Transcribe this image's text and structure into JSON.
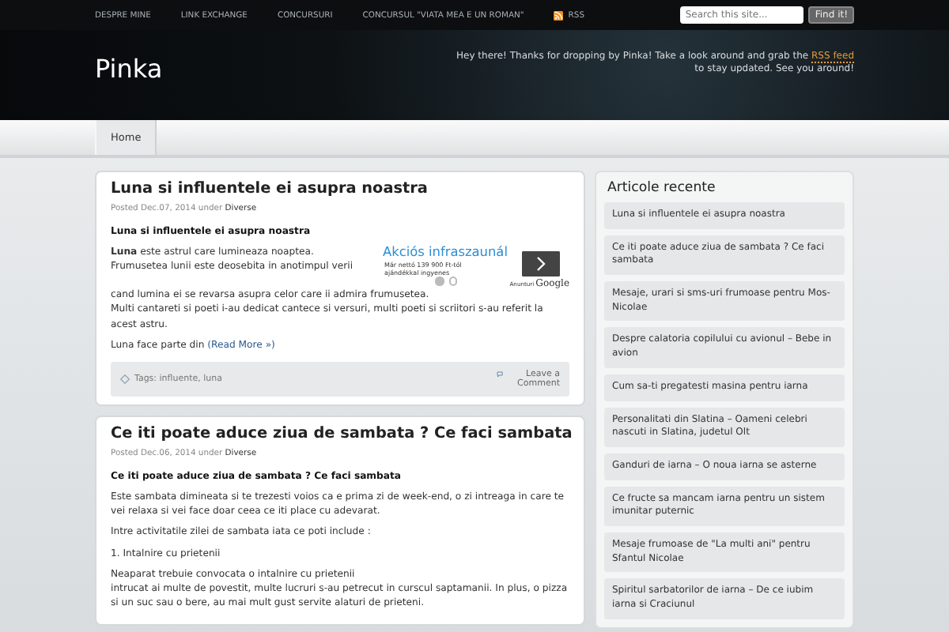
{
  "top_nav": {
    "items": [
      {
        "label": "DESPRE MINE",
        "kind": "link"
      },
      {
        "label": "LINK EXCHANGE",
        "kind": "link"
      },
      {
        "label": "CONCURSURI",
        "kind": "link"
      },
      {
        "label": "CONCURSUL \"VIATA MEA E UN ROMAN\"",
        "kind": "link"
      },
      {
        "label": "RSS",
        "kind": "rss"
      }
    ],
    "search": {
      "placeholder": "Search this site...",
      "button": "Find it!"
    }
  },
  "header": {
    "title": "Pinka",
    "tagline_before": "Hey there! Thanks for dropping by Pinka! Take a look around and grab the",
    "tagline_link": "RSS feed",
    "tagline_after": "to stay updated. See you around!"
  },
  "menu": [
    {
      "label": "Home",
      "selected": true
    }
  ],
  "posts": [
    {
      "title": "Luna si influentele ei asupra noastra",
      "posted": "Posted Dec.07, 2014 under",
      "category": "Diverse",
      "ad": {
        "title": "Akciós infraszaunál",
        "lines": [
          "Már nettó 139 900 Ft-tól",
          "ajándékkal ingyenes"
        ],
        "label": "Anunturi",
        "brand": "Google",
        "dots": [
          {
            "selected": true
          },
          {
            "selected": false
          }
        ]
      },
      "blocks": [
        {
          "kind": "heading",
          "text": "Luna si influentele ei asupra noastra"
        },
        {
          "kind": "adtext",
          "lines": [
            "**Luna** este astrul care lumineaza noaptea.",
            "Frumusetea lunii este deosebita in anotimpul verii"
          ]
        },
        {
          "kind": "text",
          "lines": [
            "cand lumina ei se revarsa asupra celor care ii admira frumusetea.",
            "Multi cantareti si poeti i-au dedicat cantece si versuri, multi poeti si scriitori s-au referit la acest astru."
          ]
        },
        {
          "kind": "more",
          "text": "Luna face parte din",
          "link": "(Read More »)"
        }
      ],
      "footer": {
        "tags": "Tags: influente, luna",
        "comment": "Leave a Comment"
      }
    },
    {
      "title": "Ce iti poate aduce ziua de sambata ? Ce faci sambata",
      "posted": "Posted Dec.06, 2014 under",
      "category": "Diverse",
      "blocks": [
        {
          "kind": "heading",
          "text": "Ce iti poate aduce ziua de sambata ? Ce faci sambata"
        },
        {
          "kind": "text",
          "lines": [
            "Este sambata dimineata si te trezesti voios ca e prima zi de week-end, o zi intreaga in care te vei relaxa si vei face doar ceea ce iti place cu adevarat."
          ]
        },
        {
          "kind": "text",
          "lines": [
            "Intre activitatile zilei de sambata iata ce poti include :"
          ]
        },
        {
          "kind": "text",
          "lines": [
            "1. Intalnire cu prietenii"
          ]
        },
        {
          "kind": "text",
          "lines": [
            "Neaparat trebuie convocata o intalnire cu prietenii",
            "intrucat ai multe de povestit, multe lucruri s-au petrecut in curscul saptamanii. In plus, o pizza si un suc sau o bere, au mai mult gust servite alaturi de prieteni."
          ]
        }
      ]
    }
  ],
  "sidebar": {
    "title": "Articole recente",
    "items": [
      "Luna si influentele ei asupra noastra",
      "Ce iti poate aduce ziua de sambata ? Ce faci sambata",
      "Mesaje, urari si sms-uri frumoase pentru Mos-Nicolae",
      "Despre calatoria copilului cu avionul – Bebe in avion",
      "Cum sa-ti pregatesti masina pentru iarna",
      "Personalitati din Slatina – Oameni celebri nascuti in Slatina, judetul Olt",
      "Ganduri de iarna – O noua iarna se asterne",
      "Ce fructe sa mancam iarna pentru un sistem imunitar puternic",
      "Mesaje frumoase de \"La multi ani\" pentru Sfantul Nicolae",
      "Spiritul sarbatorilor de iarna – De ce iubim iarna si Craciunul"
    ]
  }
}
